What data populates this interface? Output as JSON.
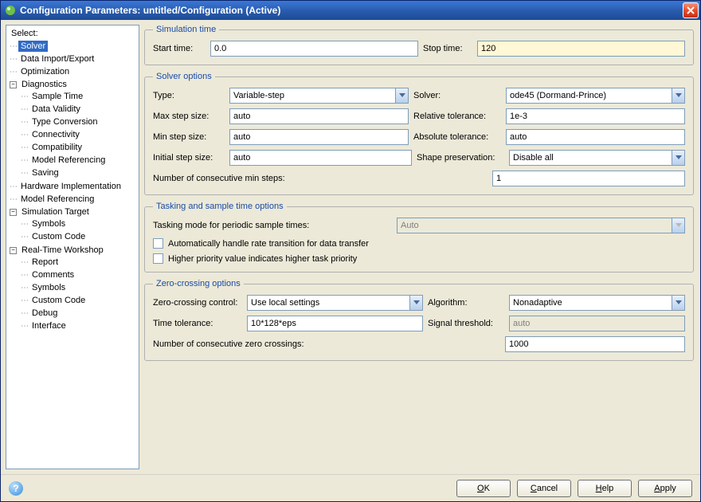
{
  "window": {
    "title": "Configuration Parameters: untitled/Configuration (Active)"
  },
  "tree": {
    "title": "Select:",
    "items": {
      "solver": "Solver",
      "data_import_export": "Data Import/Export",
      "optimization": "Optimization",
      "diagnostics": "Diagnostics",
      "sample_time": "Sample Time",
      "data_validity": "Data Validity",
      "type_conversion": "Type Conversion",
      "connectivity": "Connectivity",
      "compatibility": "Compatibility",
      "model_referencing_sub": "Model Referencing",
      "saving": "Saving",
      "hardware_impl": "Hardware Implementation",
      "model_referencing": "Model Referencing",
      "simulation_target": "Simulation Target",
      "symbols": "Symbols",
      "custom_code": "Custom Code",
      "rtw": "Real-Time Workshop",
      "report": "Report",
      "comments": "Comments",
      "symbols2": "Symbols",
      "custom_code2": "Custom Code",
      "debug": "Debug",
      "interface": "Interface"
    }
  },
  "sim_time": {
    "legend": "Simulation time",
    "start_label": "Start time:",
    "start_value": "0.0",
    "stop_label": "Stop time:",
    "stop_value": "120"
  },
  "solver_opts": {
    "legend": "Solver options",
    "type_label": "Type:",
    "type_value": "Variable-step",
    "solver_label": "Solver:",
    "solver_value": "ode45 (Dormand-Prince)",
    "max_step_label": "Max step size:",
    "max_step_value": "auto",
    "rel_tol_label": "Relative tolerance:",
    "rel_tol_value": "1e-3",
    "min_step_label": "Min step size:",
    "min_step_value": "auto",
    "abs_tol_label": "Absolute tolerance:",
    "abs_tol_value": "auto",
    "init_step_label": "Initial step size:",
    "init_step_value": "auto",
    "shape_label": "Shape preservation:",
    "shape_value": "Disable all",
    "num_min_label": "Number of consecutive min steps:",
    "num_min_value": "1"
  },
  "tasking": {
    "legend": "Tasking and sample time options",
    "mode_label": "Tasking mode for periodic sample times:",
    "mode_value": "Auto",
    "cb1": "Automatically handle rate transition for data transfer",
    "cb2": "Higher priority value indicates higher task priority"
  },
  "zero": {
    "legend": "Zero-crossing options",
    "control_label": "Zero-crossing control:",
    "control_value": "Use local settings",
    "algo_label": "Algorithm:",
    "algo_value": "Nonadaptive",
    "time_tol_label": "Time tolerance:",
    "time_tol_value": "10*128*eps",
    "sig_thresh_label": "Signal threshold:",
    "sig_thresh_value": "auto",
    "num_zc_label": "Number of consecutive zero crossings:",
    "num_zc_value": "1000"
  },
  "buttons": {
    "ok": "OK",
    "cancel": "Cancel",
    "help": "Help",
    "apply": "Apply"
  }
}
